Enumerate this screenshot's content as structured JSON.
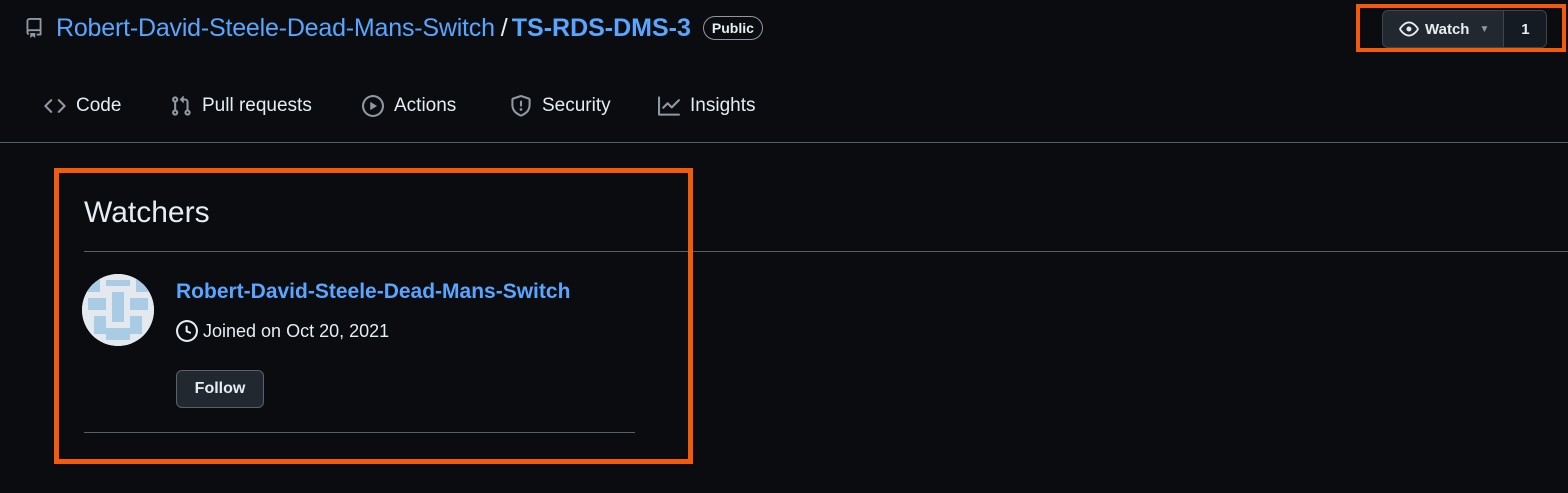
{
  "repo": {
    "owner": "Robert-David-Steele-Dead-Mans-Switch",
    "separator": "/",
    "name": "TS-RDS-DMS-3",
    "visibility": "Public",
    "icon": "repo-icon"
  },
  "watch": {
    "label": "Watch",
    "count": "1",
    "icon": "eye-icon"
  },
  "nav": {
    "tabs": [
      {
        "label": "Code",
        "icon": "code-icon"
      },
      {
        "label": "Pull requests",
        "icon": "git-pull-request-icon"
      },
      {
        "label": "Actions",
        "icon": "play-icon"
      },
      {
        "label": "Security",
        "icon": "shield-icon"
      },
      {
        "label": "Insights",
        "icon": "graph-icon"
      }
    ]
  },
  "watchers": {
    "title": "Watchers",
    "users": [
      {
        "username": "Robert-David-Steele-Dead-Mans-Switch",
        "joined": "Joined on Oct 20, 2021",
        "follow_label": "Follow"
      }
    ]
  },
  "colors": {
    "background": "#0a0c10",
    "link": "#58a6ff",
    "highlight": "#f35b0a",
    "border": "#5a5f66"
  }
}
